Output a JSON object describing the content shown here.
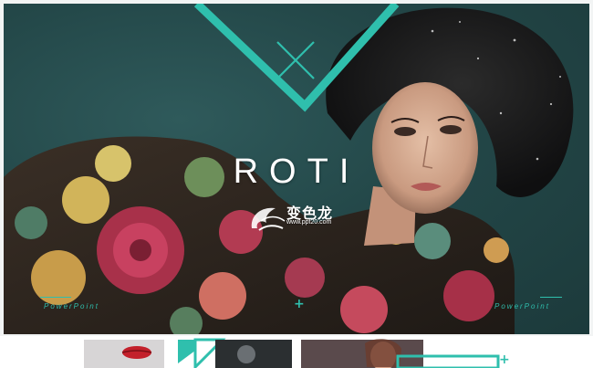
{
  "slide": {
    "title": "ROTI",
    "left_caption": "PowerPoint",
    "right_caption": "PowerPoint",
    "plus_symbol": "+"
  },
  "watermark": {
    "name": "变色龙",
    "url": "www.ppt20.com"
  },
  "colors": {
    "accent": "#2fbfad",
    "background": "#234748",
    "title": "#ffffff"
  }
}
